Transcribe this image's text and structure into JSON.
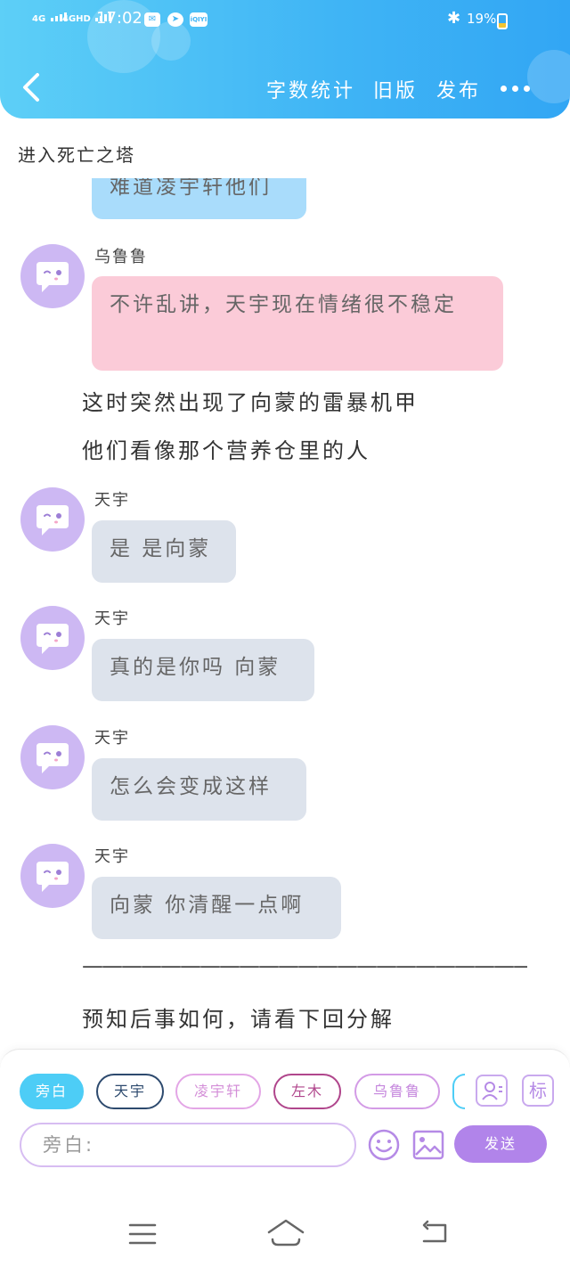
{
  "status_bar": {
    "signal1": "4G",
    "signal2": "4GHD",
    "time": "17:02",
    "app_badge": "iQIYI",
    "battery": "19%"
  },
  "header": {
    "word_count": "字数统计",
    "old_version": "旧版",
    "publish": "发布"
  },
  "story_title": "进入死亡之塔",
  "messages": [
    {
      "kind": "bubble",
      "color": "blue",
      "speaker": "",
      "text": "难道凌宇轩他们"
    },
    {
      "kind": "bubble",
      "color": "pink",
      "speaker": "乌鲁鲁",
      "text": "不许乱讲，天宇现在情绪很不稳定"
    },
    {
      "kind": "narration",
      "text": "这时突然出现了向蒙的雷暴机甲"
    },
    {
      "kind": "narration",
      "text": "他们看像那个营养仓里的人"
    },
    {
      "kind": "bubble",
      "color": "gray",
      "speaker": "天宇",
      "text": "是 是向蒙"
    },
    {
      "kind": "bubble",
      "color": "gray",
      "speaker": "天宇",
      "text": "真的是你吗 向蒙"
    },
    {
      "kind": "bubble",
      "color": "gray",
      "speaker": "天宇",
      "text": "怎么会变成这样"
    },
    {
      "kind": "bubble",
      "color": "gray",
      "speaker": "天宇",
      "text": "向蒙 你清醒一点啊"
    },
    {
      "kind": "narration",
      "text": "———————————————————————"
    },
    {
      "kind": "narration",
      "text": "预知后事如何，请看下回分解"
    }
  ],
  "characters": [
    {
      "label": "旁白",
      "color": "#4dcdf6",
      "active": true
    },
    {
      "label": "天宇",
      "color": "#2d4a6e",
      "active": false
    },
    {
      "label": "凌宇轩",
      "color": "#e3a6e6",
      "active": false
    },
    {
      "label": "左木",
      "color": "#b0468c",
      "active": false
    },
    {
      "label": "乌鲁鲁",
      "color": "#d39be6",
      "active": false
    }
  ],
  "tools": {
    "tag_button": "标"
  },
  "input": {
    "placeholder": "旁白:"
  },
  "send_label": "发送",
  "colors": {
    "header_gradient_start": "#5dcff7",
    "header_gradient_end": "#32a6f4",
    "avatar": "#cdb8f3",
    "bubble_gray": "#dde3ec",
    "bubble_pink": "#fbcbd8",
    "bubble_blue": "#a9dcfb",
    "send": "#b184ea"
  }
}
